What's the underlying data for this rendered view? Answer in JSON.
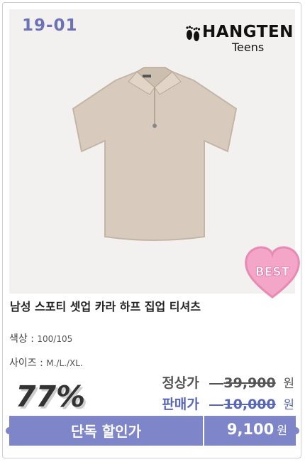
{
  "product": {
    "code": "19-01",
    "brand_name": "HANGTEN",
    "brand_sub": "Teens",
    "badge": "BEST",
    "title": "남성 스포티 셋업 카라 하프 집업 티셔츠",
    "options": {
      "color_label": "색상 :",
      "color_value": "100/105",
      "size_label": "사이즈 :",
      "size_value": "M./L./XL."
    }
  },
  "pricing": {
    "discount": "77%",
    "regular_label": "정상가",
    "regular_price": "39,900",
    "sale_label": "판매가",
    "sale_price": "10,000",
    "currency": "원",
    "cta_label": "단독 할인가",
    "final_price": "9,100"
  },
  "colors": {
    "accent": "#7e86c9",
    "code": "#6b72b8",
    "sale": "#5a67b7",
    "badge_pink": "#f3a6c8"
  },
  "icons": [
    "footprints-icon",
    "shirt-image",
    "heart-badge"
  ]
}
